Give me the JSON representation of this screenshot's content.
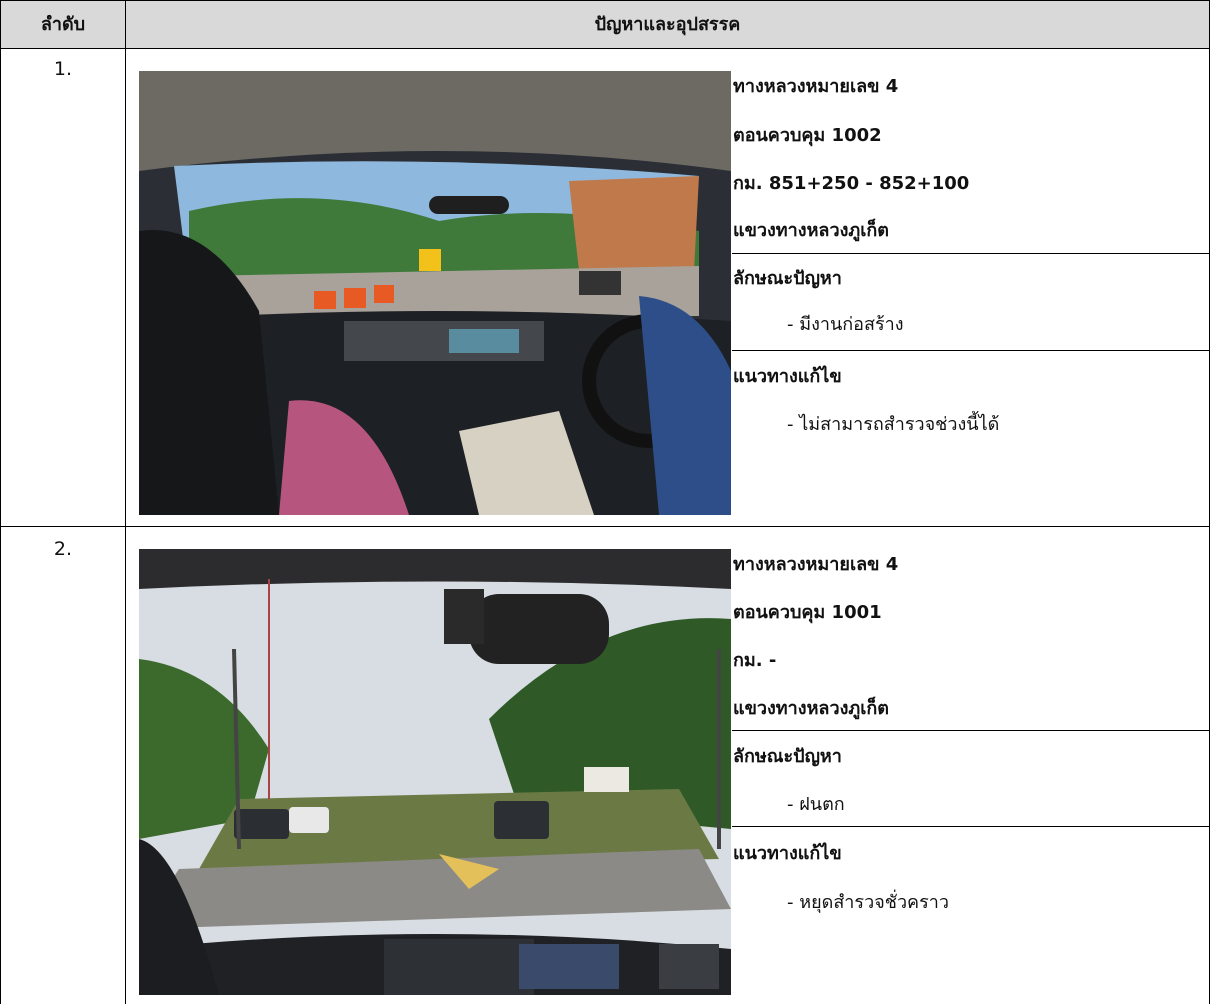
{
  "header": {
    "col_order": "ลำดับ",
    "col_problem": "ปัญหาและอุปสรรค"
  },
  "rows": [
    {
      "number": "1.",
      "photo": "car-dashboard-construction-road-photo",
      "location": [
        "ทางหลวงหมายเลข 4",
        "ตอนควบคุม 1002",
        "กม. 851+250 - 852+100",
        "แขวงทางหลวงภูเก็ต"
      ],
      "problem_title": "ลักษณะปัญหา",
      "problem": "- มีงานก่อสร้าง",
      "solution_title": "แนวทางแก้ไข",
      "solution": "- ไม่สามารถสำรวจช่วงนี้ได้"
    },
    {
      "number": "2.",
      "photo": "car-dashboard-highway-photo",
      "location": [
        "ทางหลวงหมายเลข 4",
        "ตอนควบคุม 1001",
        "กม. -",
        "แขวงทางหลวงภูเก็ต"
      ],
      "problem_title": "ลักษณะปัญหา",
      "problem": "- ฝนตก",
      "solution_title": "แนวทางแก้ไข",
      "solution": "- หยุดสำรวจชั่วคราว"
    }
  ]
}
